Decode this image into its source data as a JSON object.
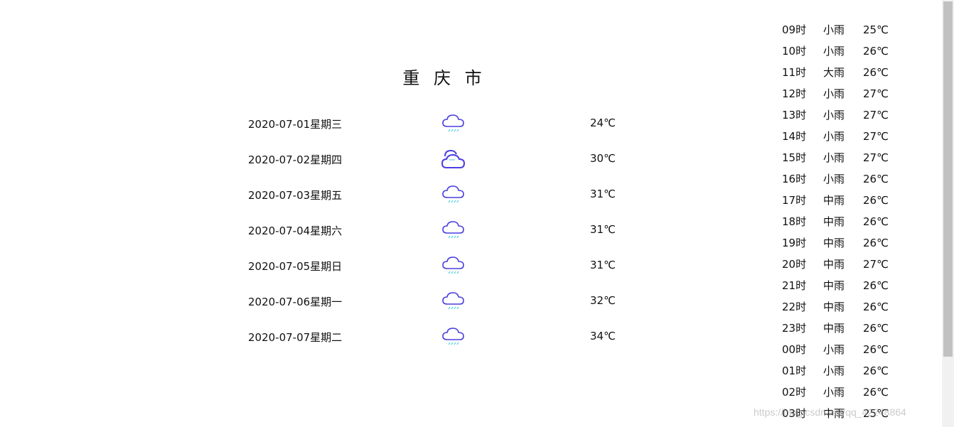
{
  "city": "重 庆 市",
  "colors": {
    "cloud_stroke": "#4a3fe0",
    "rain": "#58d6e0"
  },
  "daily": [
    {
      "date": "2020-07-01星期三",
      "icon": "cloud-rain-icon",
      "temp": "24℃"
    },
    {
      "date": "2020-07-02星期四",
      "icon": "cloud-sun-icon",
      "temp": "30℃"
    },
    {
      "date": "2020-07-03星期五",
      "icon": "cloud-rain-icon",
      "temp": "31℃"
    },
    {
      "date": "2020-07-04星期六",
      "icon": "cloud-rain-icon",
      "temp": "31℃"
    },
    {
      "date": "2020-07-05星期日",
      "icon": "cloud-rain-icon",
      "temp": "31℃"
    },
    {
      "date": "2020-07-06星期一",
      "icon": "cloud-rain-icon",
      "temp": "32℃"
    },
    {
      "date": "2020-07-07星期二",
      "icon": "cloud-rain-icon",
      "temp": "34℃"
    }
  ],
  "hourly": [
    {
      "time": "09时",
      "cond": "小雨",
      "temp": "25℃"
    },
    {
      "time": "10时",
      "cond": "小雨",
      "temp": "26℃"
    },
    {
      "time": "11时",
      "cond": "大雨",
      "temp": "26℃"
    },
    {
      "time": "12时",
      "cond": "小雨",
      "temp": "27℃"
    },
    {
      "time": "13时",
      "cond": "小雨",
      "temp": "27℃"
    },
    {
      "time": "14时",
      "cond": "小雨",
      "temp": "27℃"
    },
    {
      "time": "15时",
      "cond": "小雨",
      "temp": "27℃"
    },
    {
      "time": "16时",
      "cond": "小雨",
      "temp": "26℃"
    },
    {
      "time": "17时",
      "cond": "中雨",
      "temp": "26℃"
    },
    {
      "time": "18时",
      "cond": "中雨",
      "temp": "26℃"
    },
    {
      "time": "19时",
      "cond": "中雨",
      "temp": "26℃"
    },
    {
      "time": "20时",
      "cond": "中雨",
      "temp": "27℃"
    },
    {
      "time": "21时",
      "cond": "中雨",
      "temp": "26℃"
    },
    {
      "time": "22时",
      "cond": "中雨",
      "temp": "26℃"
    },
    {
      "time": "23时",
      "cond": "中雨",
      "temp": "26℃"
    },
    {
      "time": "00时",
      "cond": "小雨",
      "temp": "26℃"
    },
    {
      "time": "01时",
      "cond": "小雨",
      "temp": "26℃"
    },
    {
      "time": "02时",
      "cond": "小雨",
      "temp": "26℃"
    },
    {
      "time": "03时",
      "cond": "中雨",
      "temp": "25℃"
    }
  ],
  "watermark": "https://blog.csdn.net/qq_42248864"
}
